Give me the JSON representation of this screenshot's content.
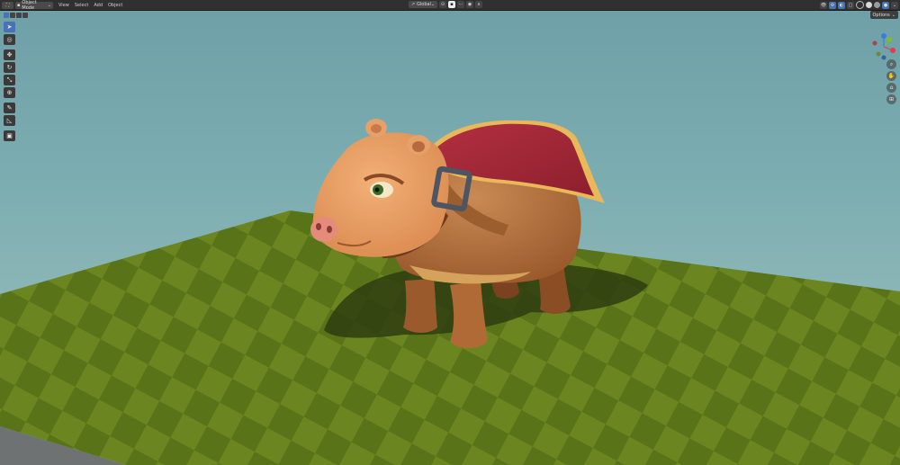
{
  "header": {
    "editor_type_icon": "view3d-icon",
    "mode": "Object Mode",
    "menus": [
      "View",
      "Select",
      "Add",
      "Object"
    ],
    "transform_orientation": "Global",
    "pivot_icon": "pivot-icon",
    "snap_icon": "magnet-icon",
    "proportional_icon": "proportional-edit-icon"
  },
  "viewport": {
    "options_label": "Options",
    "select_modes": [
      "new-selection-icon",
      "extend-selection-icon",
      "subtract-selection-icon",
      "invert-selection-icon"
    ],
    "tools": [
      {
        "name": "select-box-tool",
        "glyph": "➤",
        "active": true
      },
      {
        "name": "cursor-tool",
        "glyph": "◎",
        "active": false
      },
      {
        "name": "move-tool",
        "glyph": "✥",
        "active": false
      },
      {
        "name": "rotate-tool",
        "glyph": "↻",
        "active": false
      },
      {
        "name": "scale-tool",
        "glyph": "⤡",
        "active": false
      },
      {
        "name": "transform-tool",
        "glyph": "⊕",
        "active": false
      },
      {
        "name": "annotate-tool",
        "glyph": "✎",
        "active": false
      },
      {
        "name": "measure-tool",
        "glyph": "📐",
        "active": false
      },
      {
        "name": "add-cube-tool",
        "glyph": "▣",
        "active": false
      }
    ],
    "gizmo_axes": {
      "x": "#e23c4a",
      "y": "#7cbb2a",
      "z": "#3b7ddd"
    },
    "nav_buttons": [
      "zoom-icon",
      "hand-pan-icon",
      "camera-icon",
      "grid-ortho-icon"
    ]
  },
  "colors": {
    "accent": "#4772b3",
    "floor_light": "#6f8a22",
    "floor_dark": "#5a7418",
    "sky": "#7aacb0"
  }
}
